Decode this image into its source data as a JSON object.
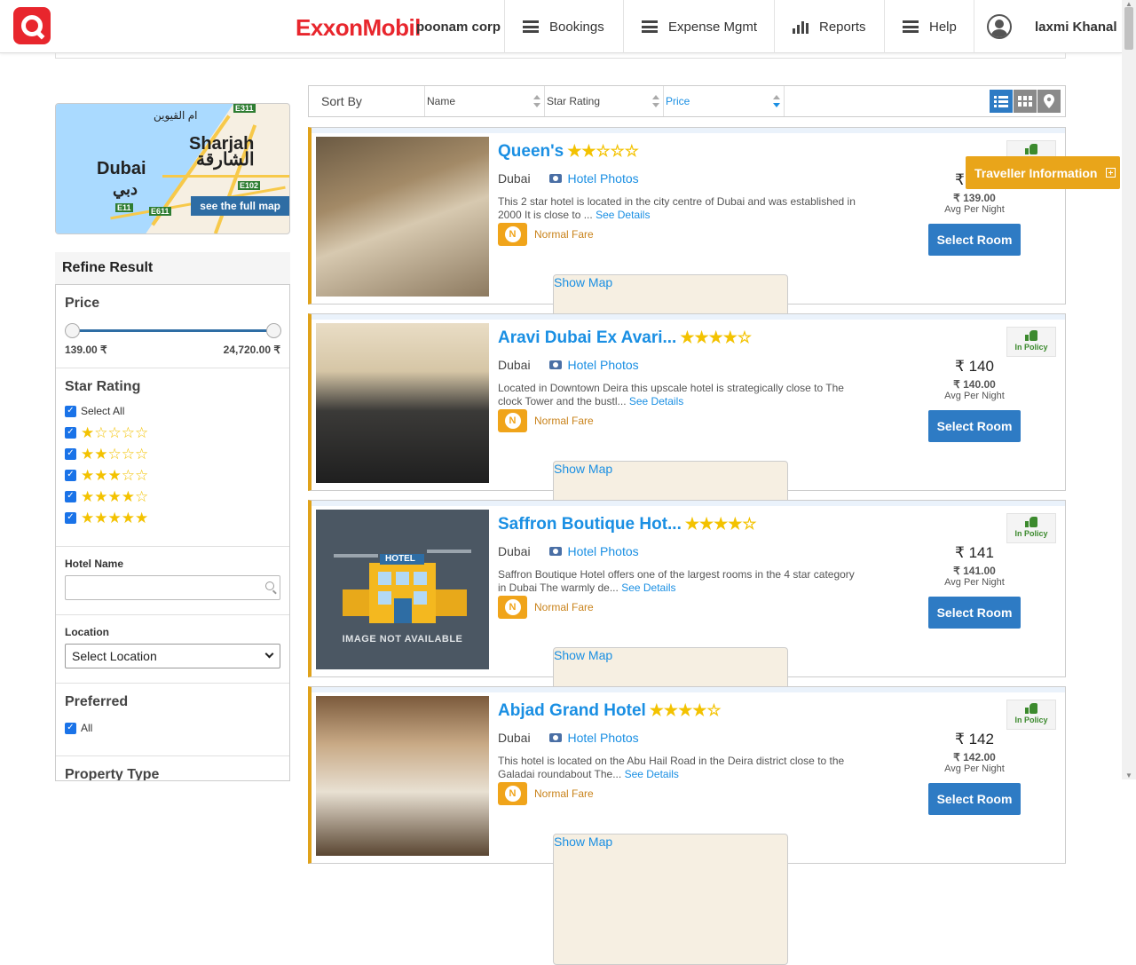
{
  "header": {
    "brand": "ExxonMobil",
    "corp": "poonam corp",
    "nav": [
      "Bookings",
      "Expense Mgmt",
      "Reports",
      "Help"
    ],
    "user": "laxmi Khanal"
  },
  "map": {
    "labels": [
      "Sharjah",
      "الشارقة",
      "Dubai",
      "دبي",
      "ام القيوين",
      "E311",
      "E102",
      "E11",
      "E611"
    ],
    "full_map_label": "see the full map"
  },
  "refine": {
    "title": "Refine Result",
    "price_label": "Price",
    "price_min": "139.00 ₹",
    "price_max": "24,720.00 ₹",
    "price_range_selected": [
      0,
      1
    ],
    "star_label": "Star Rating",
    "select_all": "Select All",
    "star_options": [
      1,
      2,
      3,
      4,
      5
    ],
    "hotel_name_label": "Hotel Name",
    "hotel_name_value": "",
    "location_label": "Location",
    "location_value": "Select Location",
    "preferred_label": "Preferred",
    "preferred_all": "All",
    "property_type_label": "Property Type"
  },
  "sortbar": {
    "sort_by": "Sort By",
    "columns": [
      "Name",
      "Star Rating",
      "Price"
    ],
    "active_column": "Price"
  },
  "traveller_info": "Traveller Information",
  "hotels": [
    {
      "name": "Queen's",
      "stars": 2,
      "city": "Dubai",
      "show_map": "Show Map",
      "photos": "Hotel Photos",
      "desc": "This 2 star hotel is located in the city centre of Dubai and was established in 2000 It is close to ...",
      "see_details": "See Details",
      "fare": "Normal Fare",
      "policy": "",
      "price": "₹ 139",
      "price_exact": "₹ 139.00",
      "avg": "Avg Per Night",
      "select": "Select Room"
    },
    {
      "name": "Aravi Dubai Ex Avari...",
      "stars": 4,
      "city": "Dubai",
      "show_map": "Show Map",
      "photos": "Hotel Photos",
      "desc": "Located in Downtown Deira this upscale hotel is strategically close to The clock Tower and the bustl...",
      "see_details": "See Details",
      "fare": "Normal Fare",
      "policy": "In Policy",
      "price": "₹ 140",
      "price_exact": "₹ 140.00",
      "avg": "Avg Per Night",
      "select": "Select Room"
    },
    {
      "name": "Saffron Boutique Hot...",
      "stars": 4,
      "city": "Dubai",
      "show_map": "Show Map",
      "photos": "Hotel Photos",
      "desc": "Saffron Boutique Hotel offers one of the largest rooms in the 4 star category in Dubai The warmly de...",
      "see_details": "See Details",
      "fare": "Normal Fare",
      "policy": "In Policy",
      "price": "₹ 141",
      "price_exact": "₹ 141.00",
      "avg": "Avg Per Night",
      "select": "Select Room",
      "image_placeholder": {
        "badge": "HOTEL",
        "text": "IMAGE NOT AVAILABLE"
      }
    },
    {
      "name": "Abjad Grand Hotel",
      "stars": 4,
      "city": "Dubai",
      "show_map": "Show Map",
      "photos": "Hotel Photos",
      "desc": "This hotel is located on the Abu Hail Road in the Deira district close to the Galadai roundabout The...",
      "see_details": "See Details",
      "fare": "Normal Fare",
      "policy": "In Policy",
      "price": "₹ 142",
      "price_exact": "₹ 142.00",
      "avg": "Avg Per Night",
      "select": "Select Room"
    }
  ]
}
